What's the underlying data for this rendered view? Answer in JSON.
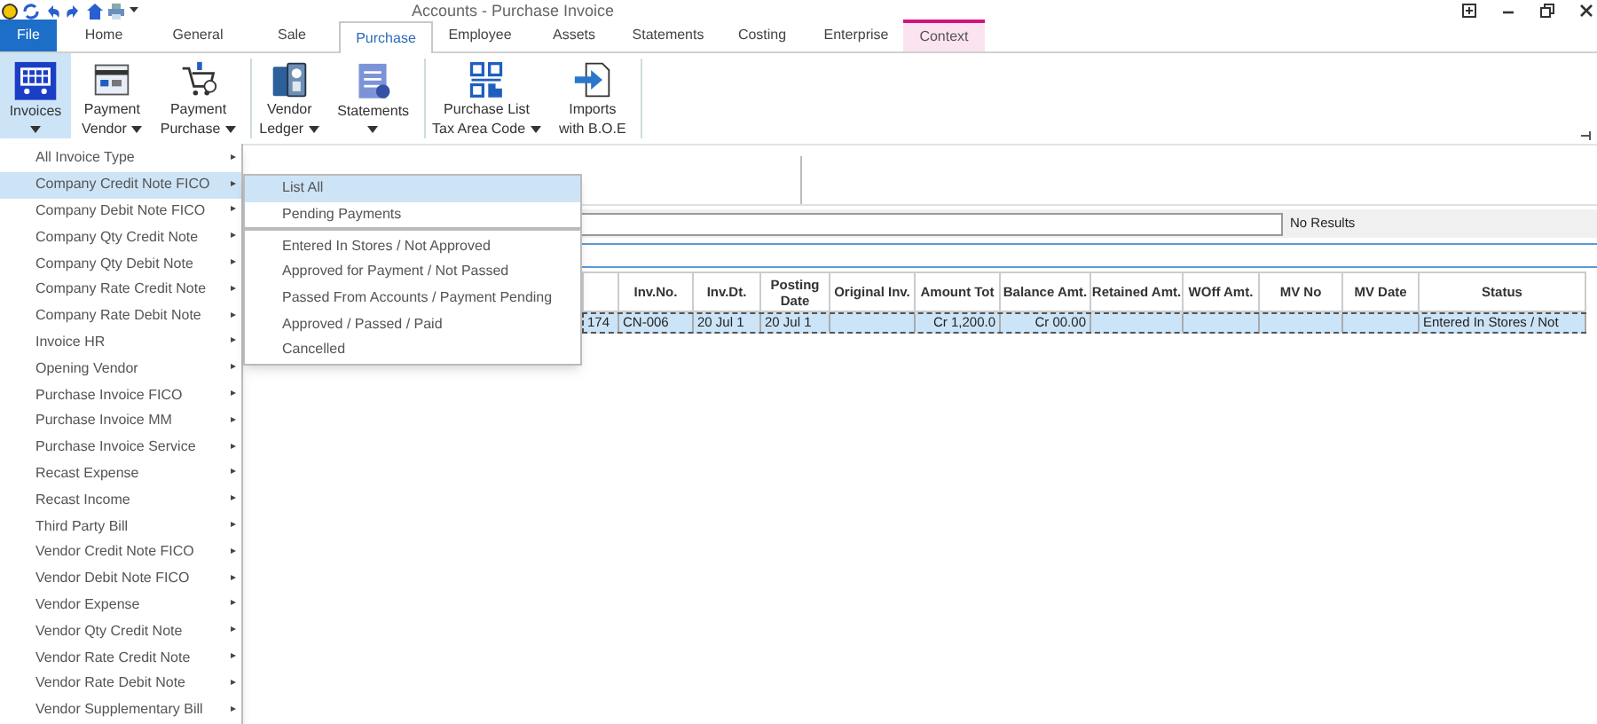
{
  "window": {
    "title": "Accounts - Purchase Invoice"
  },
  "tabs": [
    {
      "label": "File",
      "kind": "file",
      "selected": false
    },
    {
      "label": "Home",
      "kind": "normal",
      "selected": false
    },
    {
      "label": "General",
      "kind": "normal",
      "selected": false
    },
    {
      "label": "Sale",
      "kind": "normal",
      "selected": false
    },
    {
      "label": "Purchase",
      "kind": "normal",
      "selected": true
    },
    {
      "label": "Employee",
      "kind": "normal",
      "selected": false
    },
    {
      "label": "Assets",
      "kind": "normal",
      "selected": false
    },
    {
      "label": "Statements",
      "kind": "normal",
      "selected": false
    },
    {
      "label": "Costing",
      "kind": "normal",
      "selected": false
    },
    {
      "label": "Enterprise",
      "kind": "normal",
      "selected": false
    },
    {
      "label": "Context",
      "kind": "context",
      "selected": false
    }
  ],
  "ribbon": {
    "groups": [
      {
        "buttons": [
          {
            "lines": [
              "Invoices"
            ],
            "dropdown": true,
            "selected": true
          },
          {
            "lines": [
              "Payment",
              "Vendor"
            ],
            "dropdown": true,
            "selected": false
          },
          {
            "lines": [
              "Payment",
              "Purchase"
            ],
            "dropdown": true,
            "selected": false
          }
        ]
      },
      {
        "buttons": [
          {
            "lines": [
              "Vendor",
              "Ledger"
            ],
            "dropdown": true,
            "selected": false
          },
          {
            "lines": [
              "Statements"
            ],
            "dropdown": true,
            "selected": false
          }
        ]
      },
      {
        "buttons": [
          {
            "lines": [
              "Purchase List",
              "Tax Area Code"
            ],
            "dropdown": true,
            "selected": false
          },
          {
            "lines": [
              "Imports",
              "with B.O.E"
            ],
            "dropdown": false,
            "selected": false
          }
        ]
      }
    ]
  },
  "search": {
    "status": "No Results"
  },
  "table": {
    "columns": [
      "",
      "Inv.No.",
      "Inv.Dt.",
      "Posting Date",
      "Original Inv.",
      "Amount Tot",
      "Balance Amt.",
      "Retained Amt.",
      "WOff Amt.",
      "MV No",
      "MV Date",
      "Status"
    ],
    "rows": [
      {
        "selected": true,
        "cells": [
          "174",
          "CN-006",
          "20 Jul 1",
          "20 Jul 1",
          "",
          "Cr 1,200.0",
          "Cr 00.00",
          "",
          "",
          "",
          "",
          "Entered In Stores / Not"
        ]
      }
    ]
  },
  "menu": {
    "items": [
      {
        "label": "All Invoice Type",
        "selected": false
      },
      {
        "label": "Company Credit Note FICO",
        "selected": true
      },
      {
        "label": "Company Debit Note FICO",
        "selected": false
      },
      {
        "label": "Company Qty Credit Note",
        "selected": false
      },
      {
        "label": "Company Qty Debit Note",
        "selected": false
      },
      {
        "label": "Company Rate Credit Note",
        "selected": false
      },
      {
        "label": "Company Rate Debit Note",
        "selected": false
      },
      {
        "label": "Invoice HR",
        "selected": false
      },
      {
        "label": "Opening Vendor",
        "selected": false
      },
      {
        "label": "Purchase Invoice FICO",
        "selected": false
      },
      {
        "label": "Purchase Invoice MM",
        "selected": false
      },
      {
        "label": "Purchase Invoice Service",
        "selected": false
      },
      {
        "label": "Recast Expense",
        "selected": false
      },
      {
        "label": "Recast Income",
        "selected": false
      },
      {
        "label": "Third Party Bill",
        "selected": false
      },
      {
        "label": "Vendor Credit Note FICO",
        "selected": false
      },
      {
        "label": "Vendor Debit Note FICO",
        "selected": false
      },
      {
        "label": "Vendor Expense",
        "selected": false
      },
      {
        "label": "Vendor Qty Credit Note",
        "selected": false
      },
      {
        "label": "Vendor Rate Credit Note",
        "selected": false
      },
      {
        "label": "Vendor Rate Debit Note",
        "selected": false
      },
      {
        "label": "Vendor Supplementary Bill",
        "selected": false
      }
    ],
    "arrow": "▸"
  },
  "submenu": {
    "groups": [
      {
        "items": [
          {
            "label": "List All",
            "selected": true
          },
          {
            "label": "Pending Payments",
            "selected": false
          }
        ]
      },
      {
        "items": [
          {
            "label": "Entered In Stores / Not Approved",
            "selected": false
          },
          {
            "label": "Approved for Payment / Not Passed",
            "selected": false
          },
          {
            "label": "Passed From Accounts / Payment Pending",
            "selected": false
          },
          {
            "label": "Approved / Passed / Paid",
            "selected": false
          },
          {
            "label": "Cancelled",
            "selected": false
          }
        ]
      }
    ]
  }
}
